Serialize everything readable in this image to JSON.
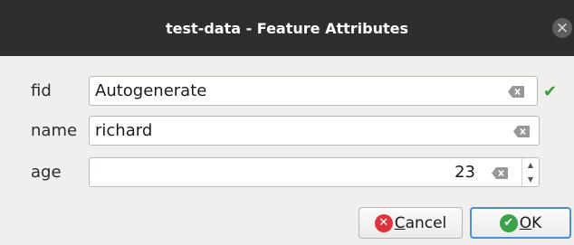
{
  "window": {
    "title": "test-data - Feature Attributes"
  },
  "fields": {
    "fid": {
      "label": "fid",
      "value": "Autogenerate"
    },
    "name": {
      "label": "name",
      "value": "richard"
    },
    "age": {
      "label": "age",
      "value": "23"
    }
  },
  "buttons": {
    "cancel_mnemonic": "C",
    "cancel_rest": "ancel",
    "ok_mnemonic": "O",
    "ok_rest": "K"
  },
  "icons": {
    "close": "close-icon",
    "clear": "clear-text-icon",
    "valid": "checkmark-icon",
    "cancel": "cancel-x-icon",
    "ok": "ok-check-icon"
  },
  "colors": {
    "titlebar": "#2e2e2e",
    "cancel_icon": "#e0343c",
    "ok_icon": "#3aa34a",
    "valid_check": "#3b9c3b",
    "focus_border": "#4b8fd6"
  }
}
